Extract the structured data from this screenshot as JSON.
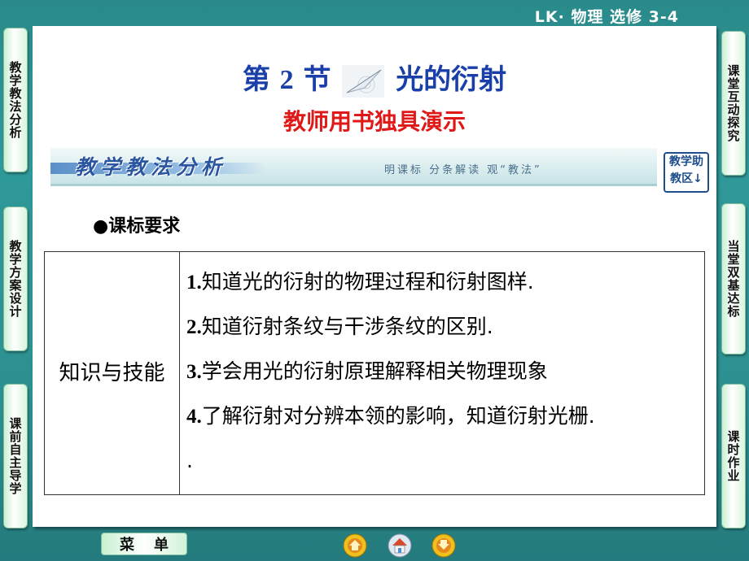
{
  "header": {
    "course": "LK· 物理  选修  3-4"
  },
  "left_nav": [
    {
      "label": "教学教法分析"
    },
    {
      "label": "教学方案设计"
    },
    {
      "label": "课前自主导学"
    }
  ],
  "right_nav": [
    {
      "label": "课堂互动探究"
    },
    {
      "label": "当堂双基达标"
    },
    {
      "label": "课时作业"
    }
  ],
  "title": {
    "prefix": "第 ",
    "number": "2",
    "suffix": " 节",
    "text": "光的衍射"
  },
  "subtitle": "教师用书独具演示",
  "banner": {
    "title": "教学教法分析",
    "subtitle": "明课标  分条解读  观“教法”",
    "help_button": "教学助教区↓"
  },
  "requirements": {
    "heading": "●课标要求",
    "category": "知识与技能",
    "items": [
      {
        "num": "1.",
        "text": "知道光的衍射的物理过程和衍射图样."
      },
      {
        "num": "2.",
        "text": "知道衍射条纹与干涉条纹的区别."
      },
      {
        "num": "3.",
        "text": "学会用光的衍射原理解释相关物理现象"
      },
      {
        "num": "4.",
        "text": "了解衍射对分辨本领的影响，知道衍射光栅."
      },
      {
        "num": "",
        "text": "."
      }
    ]
  },
  "footer": {
    "menu_label_1": "菜",
    "menu_label_2": "单",
    "icons": [
      "prev-icon",
      "home-icon",
      "next-icon"
    ],
    "colors": {
      "prev": "#e6b800",
      "home": "#d84a2a",
      "next": "#e6b800"
    }
  }
}
